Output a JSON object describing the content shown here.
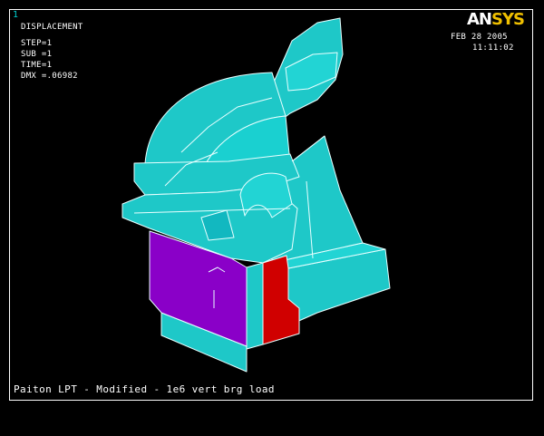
{
  "window_number": "1",
  "result_info": {
    "title": "DISPLACEMENT",
    "step": "STEP=1",
    "sub": "SUB =1",
    "time": "TIME=1",
    "dmx": "DMX =.06982"
  },
  "logo": {
    "part1": "AN",
    "part2": "SYS"
  },
  "date": "FEB 28 2005",
  "time": "11:11:02",
  "caption": "Paiton LPT - Modified - 1e6 vert brg load",
  "colors": {
    "background": "#000000",
    "mesh": "#1ec8c8",
    "edge": "#e8ffff",
    "purple": "#8a00c8",
    "red": "#d00000",
    "logo_accent": "#f0c000"
  }
}
